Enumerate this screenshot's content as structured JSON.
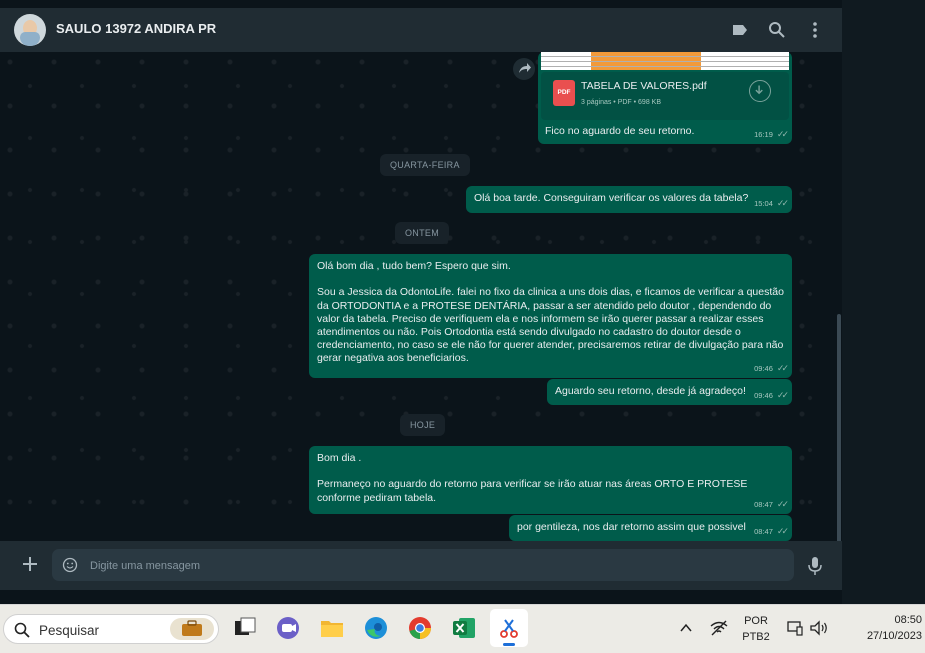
{
  "header": {
    "contact_name": "SAULO 13972 ANDIRA PR",
    "icons": [
      "label-icon",
      "search-icon",
      "menu-icon"
    ]
  },
  "chat": {
    "document": {
      "file_name": "TABELA DE VALORES.pdf",
      "file_info": "3 páginas • PDF • 698 KB",
      "icon_label": "PDF",
      "caption": "Fico no aguardo de seu retorno.",
      "time": "16:19"
    },
    "separators": [
      "QUARTA-FEIRA",
      "ONTEM",
      "HOJE"
    ],
    "messages": [
      {
        "text": "Olá boa tarde. Conseguiram verificar os valores da tabela?",
        "time": "15:04"
      },
      {
        "text": "Olá bom dia , tudo bem? Espero que sim.\n\nSou a Jessica da OdontoLife. falei no fixo da clinica a uns dois dias, e ficamos de verificar a questão da ORTODONTIA e a PROTESE DENTÁRIA, passar a ser atendido pelo doutor , dependendo do valor da tabela. Preciso de verifiquem ela e nos informem se irão querer passar a realizar esses atendimentos ou não. Pois Ortodontia está sendo divulgado no cadastro do doutor desde o credenciamento, no caso se ele não for querer atender, precisaremos retirar de divulgação para não gerar negativa aos beneficiarios.",
        "time": "09:46"
      },
      {
        "text": "Aguardo seu retorno, desde já agradeço!",
        "time": "09:46"
      },
      {
        "text": "Bom dia .\n\nPermaneço no aguardo do retorno para verificar se irão atuar nas áreas ORTO E PROTESE conforme pediram tabela.",
        "time": "08:47"
      },
      {
        "text": "por gentileza, nos dar retorno assim que possivel",
        "time": "08:47"
      }
    ]
  },
  "composer": {
    "placeholder": "Digite uma mensagem"
  },
  "taskbar": {
    "search_label": "Pesquisar",
    "language": "POR",
    "layout": "PTB2",
    "time": "08:50",
    "date": "27/10/2023"
  },
  "colors": {
    "outgoing_bubble": "#005c4b",
    "header_bg": "#202c33",
    "chat_bg": "#0b141a"
  }
}
